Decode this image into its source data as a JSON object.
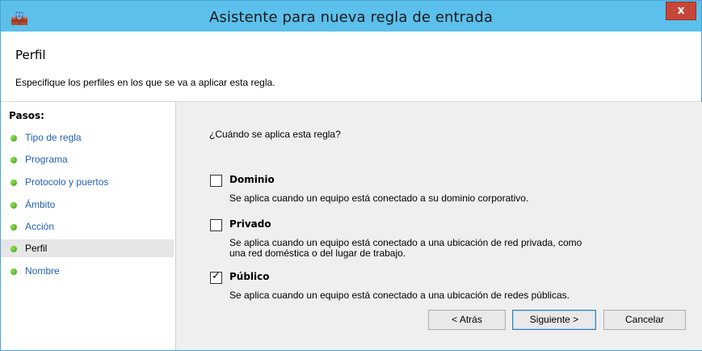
{
  "window": {
    "title": "Asistente para nueva regla de entrada",
    "close_label": "x"
  },
  "header": {
    "title": "Perfil",
    "description": "Especifique los perfiles en los que se va a aplicar esta regla."
  },
  "sidebar": {
    "steps_title": "Pasos:",
    "steps": [
      {
        "label": "Tipo de regla",
        "active": false
      },
      {
        "label": "Programa",
        "active": false
      },
      {
        "label": "Protocolo y puertos",
        "active": false
      },
      {
        "label": "Ámbito",
        "active": false
      },
      {
        "label": "Acción",
        "active": false
      },
      {
        "label": "Perfil",
        "active": true
      },
      {
        "label": "Nombre",
        "active": false
      }
    ]
  },
  "main": {
    "question": "¿Cuándo se aplica esta regla?",
    "options": [
      {
        "label": "Dominio",
        "checked": false,
        "description": "Se aplica cuando un equipo está conectado a su dominio corporativo."
      },
      {
        "label": "Privado",
        "checked": false,
        "description_line1": "Se aplica cuando un equipo está conectado a una ubicación de red privada, como",
        "description_line2": "una red doméstica o del lugar de trabajo."
      },
      {
        "label": "Público",
        "checked": true,
        "description": "Se aplica cuando un equipo está conectado a una ubicación de redes públicas."
      }
    ]
  },
  "buttons": {
    "back": "< Atrás",
    "next": "Siguiente >",
    "cancel": "Cancelar"
  },
  "colors": {
    "titlebar": "#5cc0ec",
    "link": "#1f5fb6",
    "close": "#c7463a",
    "active_step": "#e6e6e6",
    "content_bg": "#efefef"
  },
  "icons": {
    "app": "firewall-icon",
    "step": "green-dot-icon",
    "check": "checkmark-icon"
  }
}
